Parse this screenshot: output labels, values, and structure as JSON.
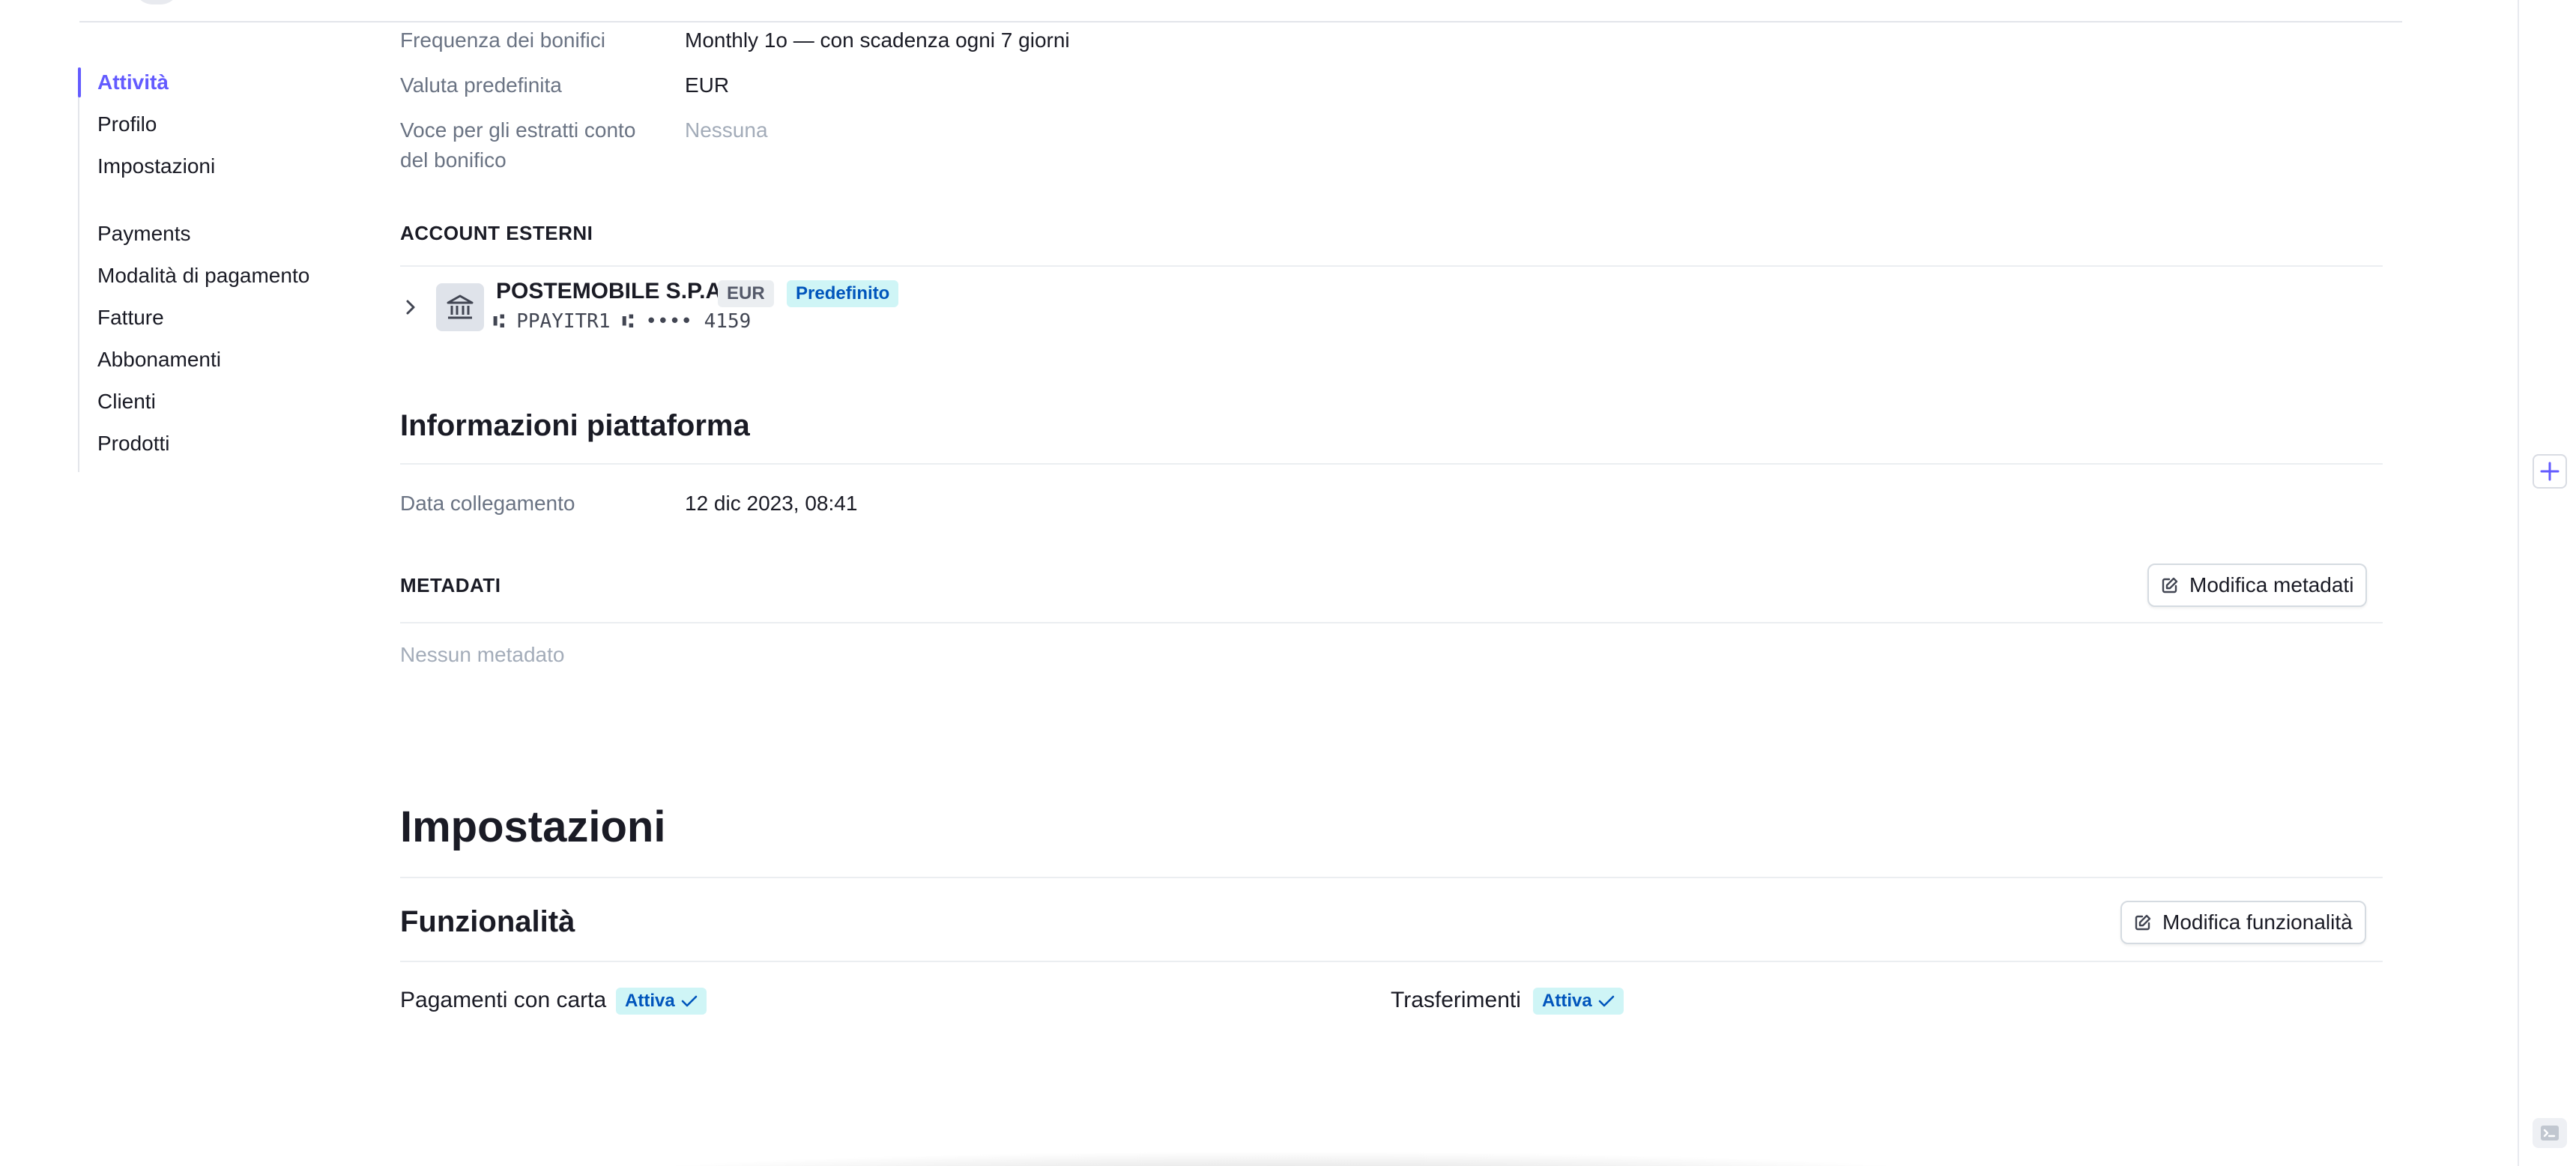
{
  "sidebar": {
    "items": [
      {
        "label": "Attività",
        "active": true
      },
      {
        "label": "Profilo"
      },
      {
        "label": "Impostazioni"
      },
      {
        "label": "Payments"
      },
      {
        "label": "Modalità di pagamento"
      },
      {
        "label": "Fatture"
      },
      {
        "label": "Abbonamenti"
      },
      {
        "label": "Clienti"
      },
      {
        "label": "Prodotti"
      }
    ]
  },
  "details": {
    "frequency_label": "Frequenza dei bonifici",
    "frequency_value": "Monthly 1o — con scadenza ogni 7 giorni",
    "currency_label": "Valuta predefinita",
    "currency_value": "EUR",
    "statement_label_line1": "Voce per gli estratti conto",
    "statement_label_line2": "del bonifico",
    "statement_value": "Nessuna"
  },
  "external_accounts": {
    "heading": "ACCOUNT ESTERNI",
    "bank_name": "POSTEMOBILE S.P.A.",
    "currency_badge": "EUR",
    "default_badge": "Predefinito",
    "account_number": "⑆ PPAYITR1 ⑆ •••• 4159"
  },
  "platform": {
    "heading": "Informazioni piattaforma",
    "connected_label": "Data collegamento",
    "connected_value": "12 dic 2023, 08:41"
  },
  "metadata": {
    "heading": "METADATI",
    "edit_button": "Modifica metadati",
    "empty_text": "Nessun metadato"
  },
  "settings": {
    "heading": "Impostazioni",
    "features_heading": "Funzionalità",
    "edit_features_button": "Modifica funzionalità",
    "features": [
      {
        "label": "Pagamenti con carta",
        "status": "Attiva"
      },
      {
        "label": "Trasferimenti",
        "status": "Attiva"
      }
    ]
  },
  "colors": {
    "accent": "#635bff",
    "badge_blue_bg": "#cff5f6",
    "badge_blue_text": "#0055bc"
  }
}
